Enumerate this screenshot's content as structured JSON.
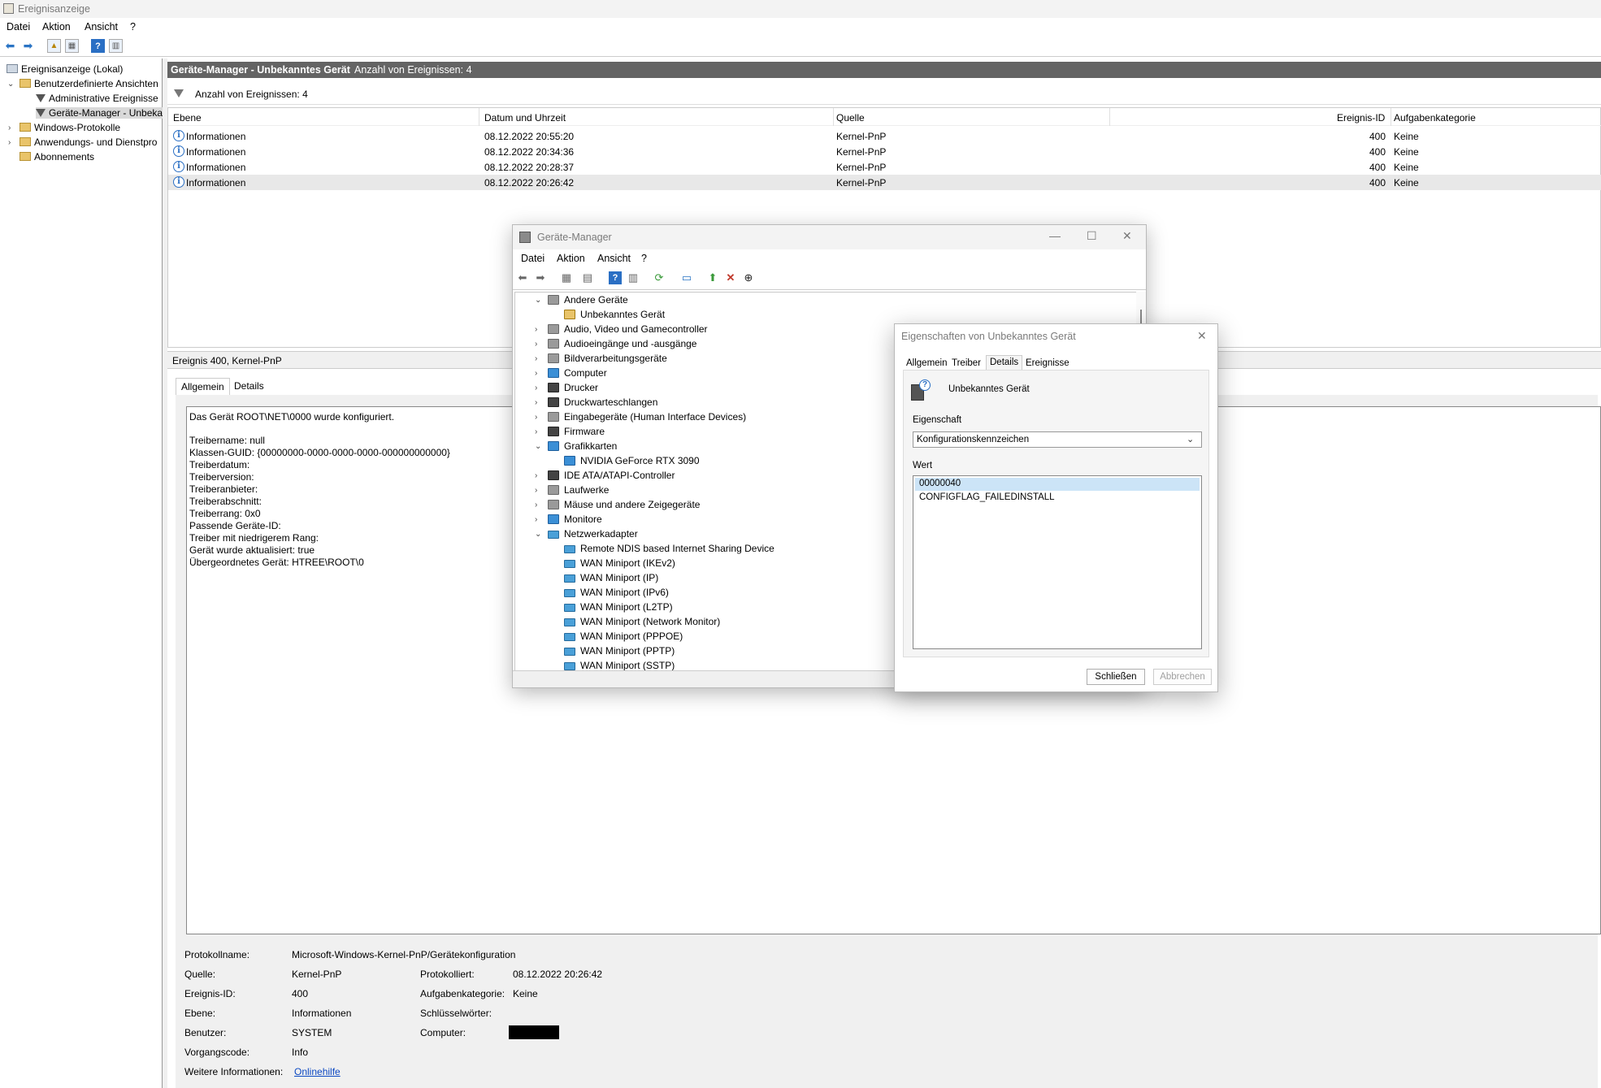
{
  "app": {
    "title": "Ereignisanzeige"
  },
  "menu": [
    "Datei",
    "Aktion",
    "Ansicht",
    "?"
  ],
  "tree": {
    "root": "Ereignisanzeige (Lokal)",
    "custom_views": "Benutzerdefinierte Ansichten",
    "admin_events": "Administrative Ereignisse",
    "device_manager_view": "Geräte-Manager - Unbeka",
    "windows_logs": "Windows-Protokolle",
    "app_service_logs": "Anwendungs- und Dienstpro",
    "subscriptions": "Abonnements"
  },
  "main_header": {
    "title": "Geräte-Manager - Unbekanntes Gerät",
    "count": "Anzahl von Ereignissen: 4"
  },
  "filter_text": "Anzahl von Ereignissen: 4",
  "columns": [
    "Ebene",
    "Datum und Uhrzeit",
    "Quelle",
    "Ereignis-ID",
    "Aufgabenkategorie"
  ],
  "events": [
    {
      "level": "Informationen",
      "date": "08.12.2022 20:55:20",
      "source": "Kernel-PnP",
      "id": "400",
      "category": "Keine"
    },
    {
      "level": "Informationen",
      "date": "08.12.2022 20:34:36",
      "source": "Kernel-PnP",
      "id": "400",
      "category": "Keine"
    },
    {
      "level": "Informationen",
      "date": "08.12.2022 20:28:37",
      "source": "Kernel-PnP",
      "id": "400",
      "category": "Keine"
    },
    {
      "level": "Informationen",
      "date": "08.12.2022 20:26:42",
      "source": "Kernel-PnP",
      "id": "400",
      "category": "Keine"
    }
  ],
  "detail": {
    "header": "Ereignis 400, Kernel-PnP",
    "tabs": [
      "Allgemein",
      "Details"
    ],
    "lines": [
      "Das Gerät ROOT\\NET\\0000 wurde konfiguriert.",
      "",
      "Treibername: null",
      "Klassen-GUID: {00000000-0000-0000-0000-000000000000}",
      "Treiberdatum:",
      "Treiberversion:",
      "Treiberanbieter:",
      "Treiberabschnitt:",
      "Treiberrang: 0x0",
      "Passende Geräte-ID:",
      "Treiber mit niedrigerem Rang:",
      "Gerät wurde aktualisiert: true",
      "Übergeordnetes Gerät: HTREE\\ROOT\\0"
    ],
    "log_name_label": "Protokollname:",
    "log_name": "Microsoft-Windows-Kernel-PnP/Gerätekonfiguration",
    "source_label": "Quelle:",
    "source": "Kernel-PnP",
    "logged_label": "Protokolliert:",
    "logged": "08.12.2022 20:26:42",
    "event_id_label": "Ereignis-ID:",
    "event_id": "400",
    "task_label": "Aufgabenkategorie:",
    "task": "Keine",
    "level_label": "Ebene:",
    "level": "Informationen",
    "keywords_label": "Schlüsselwörter:",
    "user_label": "Benutzer:",
    "user": "SYSTEM",
    "computer_label": "Computer:",
    "opcode_label": "Vorgangscode:",
    "opcode": "Info",
    "more_label": "Weitere Informationen:",
    "more_link": "Onlinehilfe"
  },
  "device_manager": {
    "title": "Geräte-Manager",
    "menu": [
      "Datei",
      "Aktion",
      "Ansicht",
      "?"
    ],
    "nodes": [
      {
        "label": "Andere Geräte",
        "level": 0,
        "expanded": true,
        "icon": "other-devices-icon"
      },
      {
        "label": "Unbekanntes Gerät",
        "level": 1,
        "icon": "unknown-device-warning-icon"
      },
      {
        "label": "Audio, Video und Gamecontroller",
        "level": 0,
        "icon": "speaker-icon"
      },
      {
        "label": "Audioeingänge und -ausgänge",
        "level": 0,
        "icon": "speaker-icon"
      },
      {
        "label": "Bildverarbeitungsgeräte",
        "level": 0,
        "icon": "camera-icon"
      },
      {
        "label": "Computer",
        "level": 0,
        "icon": "monitor-icon"
      },
      {
        "label": "Drucker",
        "level": 0,
        "icon": "printer-icon"
      },
      {
        "label": "Druckwarteschlangen",
        "level": 0,
        "icon": "printer-icon"
      },
      {
        "label": "Eingabegeräte (Human Interface Devices)",
        "level": 0,
        "icon": "hid-icon"
      },
      {
        "label": "Firmware",
        "level": 0,
        "icon": "chip-icon"
      },
      {
        "label": "Grafikkarten",
        "level": 0,
        "expanded": true,
        "icon": "display-adapter-icon"
      },
      {
        "label": "NVIDIA GeForce RTX 3090",
        "level": 1,
        "icon": "display-adapter-icon"
      },
      {
        "label": "IDE ATA/ATAPI-Controller",
        "level": 0,
        "icon": "controller-icon"
      },
      {
        "label": "Laufwerke",
        "level": 0,
        "icon": "drive-icon"
      },
      {
        "label": "Mäuse und andere Zeigegeräte",
        "level": 0,
        "icon": "mouse-icon"
      },
      {
        "label": "Monitore",
        "level": 0,
        "icon": "monitor-icon"
      },
      {
        "label": "Netzwerkadapter",
        "level": 0,
        "expanded": true,
        "icon": "network-adapter-icon"
      },
      {
        "label": "Remote NDIS based Internet Sharing Device",
        "level": 1,
        "icon": "network-adapter-icon"
      },
      {
        "label": "WAN Miniport (IKEv2)",
        "level": 1,
        "icon": "network-adapter-icon"
      },
      {
        "label": "WAN Miniport (IP)",
        "level": 1,
        "icon": "network-adapter-icon"
      },
      {
        "label": "WAN Miniport (IPv6)",
        "level": 1,
        "icon": "network-adapter-icon"
      },
      {
        "label": "WAN Miniport (L2TP)",
        "level": 1,
        "icon": "network-adapter-icon"
      },
      {
        "label": "WAN Miniport (Network Monitor)",
        "level": 1,
        "icon": "network-adapter-icon"
      },
      {
        "label": "WAN Miniport (PPPOE)",
        "level": 1,
        "icon": "network-adapter-icon"
      },
      {
        "label": "WAN Miniport (PPTP)",
        "level": 1,
        "icon": "network-adapter-icon"
      },
      {
        "label": "WAN Miniport (SSTP)",
        "level": 1,
        "icon": "network-adapter-icon"
      }
    ]
  },
  "properties": {
    "title": "Eigenschaften von Unbekanntes Gerät",
    "tabs": [
      "Allgemein",
      "Treiber",
      "Details",
      "Ereignisse"
    ],
    "active_tab": "Details",
    "device_name": "Unbekanntes Gerät",
    "property_label": "Eigenschaft",
    "property_value": "Konfigurationskennzeichen",
    "value_label": "Wert",
    "values": [
      "00000040",
      "CONFIGFLAG_FAILEDINSTALL"
    ],
    "close_button": "Schließen",
    "cancel_button": "Abbrechen"
  }
}
